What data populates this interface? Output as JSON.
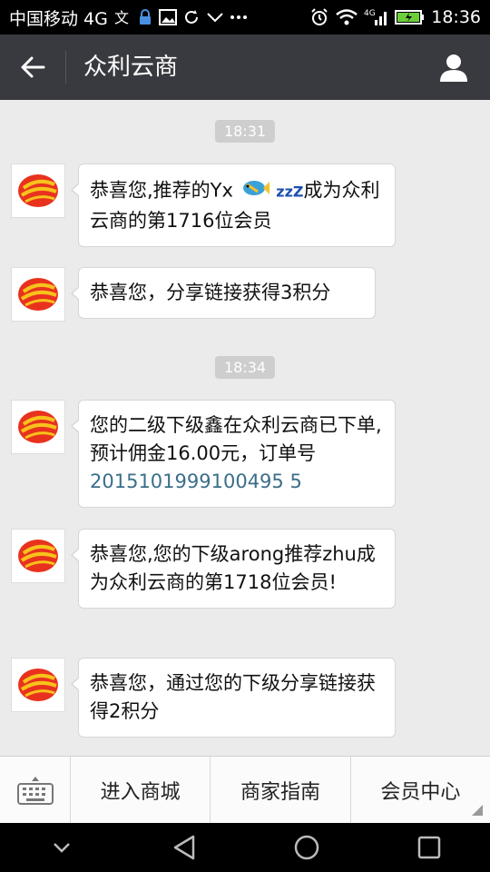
{
  "status_bar": {
    "carrier": "中国移动 4G",
    "time": "18:36",
    "network_label": "4G",
    "battery_color": "#6ccf3a"
  },
  "header": {
    "title": "众利云商",
    "back_icon": "arrow-left-icon",
    "profile_icon": "person-icon"
  },
  "chat": {
    "items": [
      {
        "type": "timestamp",
        "text": "18:31"
      },
      {
        "type": "message",
        "parts": [
          "恭喜您,推荐的Yx ",
          "成为众利云商的第1716位会员"
        ]
      },
      {
        "type": "message",
        "text": "恭喜您，分享链接获得3积分"
      },
      {
        "type": "timestamp",
        "text": "18:34"
      },
      {
        "type": "message",
        "text": "您的二级下级鑫在众利云商已下单,预计佣金16.00元，订单号",
        "link": "2015101999100495 5"
      },
      {
        "type": "message",
        "text": "恭喜您,您的下级arong推荐zhu成为众利云商的第1718位会员!"
      },
      {
        "type": "message",
        "text": "恭喜您，通过您的下级分享链接获得2积分"
      }
    ],
    "emoji_text": "zzZ",
    "link_color": "#3b6e8a"
  },
  "menu": {
    "items": [
      "进入商城",
      "商家指南",
      "会员中心"
    ],
    "keyboard_icon": "keyboard-icon"
  },
  "nav": {
    "icons": [
      "chevron-down-icon",
      "back-triangle-icon",
      "home-circle-icon",
      "recents-square-icon"
    ]
  }
}
